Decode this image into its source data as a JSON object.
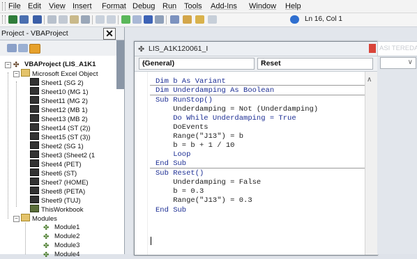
{
  "menu": {
    "items": [
      "File",
      "Edit",
      "View",
      "Insert",
      "Format",
      "Debug",
      "Run",
      "Tools",
      "Add-Ins",
      "Window",
      "Help"
    ]
  },
  "toolbar": {
    "cursor_position": "Ln 16, Col 1",
    "icons": [
      "excel-icon",
      "insert-icon",
      "save-icon",
      "cut-icon",
      "copy-icon",
      "paste-icon",
      "find-icon",
      "undo-icon",
      "redo-icon",
      "run-icon",
      "break-icon",
      "reset-icon",
      "design-mode-icon",
      "project-explorer-icon",
      "properties-icon",
      "object-browser-icon",
      "toolbox-icon",
      "help-icon"
    ]
  },
  "project_panel": {
    "title": "Project - VBAProject",
    "close_label": "✕",
    "root": "VBAProject (LIS_A1K1",
    "objects_folder": "Microsoft Excel Object",
    "sheets": [
      "Sheet1 (SG 2)",
      "Sheet10 (MG 1)",
      "Sheet11 (MG 2)",
      "Sheet12 (MB 1)",
      "Sheet13 (MB 2)",
      "Sheet14 (ST (2))",
      "Sheet15 (ST (3))",
      "Sheet2 (SG 1)",
      "Sheet3 (Sheet2 (1",
      "Sheet4 (PET)",
      "Sheet6 (ST)",
      "Sheet7 (HOME)",
      "Sheet8 (PETA)",
      "Sheet9 (TUJ)"
    ],
    "workbook": "ThisWorkbook",
    "modules_folder": "Modules",
    "modules": [
      "Module1",
      "Module2",
      "Module3",
      "Module4"
    ]
  },
  "code_window": {
    "title": "LIS_A1K120061_I",
    "object_combo": "(General)",
    "procedure_combo": "Reset",
    "lines": [
      "Dim b As Variant",
      "Dim Underdamping As Boolean",
      "Sub RunStop()",
      "    Underdamping = Not (Underdamping)",
      "    Do While Underdamping = True",
      "    DoEvents",
      "    Range(\"J13\") = b",
      "    b = b + 1 / 10",
      "    Loop",
      "End Sub",
      "Sub Reset()",
      "    Underdamping = False",
      "    b = 0.3",
      "    Range(\"J13\") = 0.3",
      "End Sub"
    ]
  },
  "right_panel": {
    "title": "ASI TEREDA"
  }
}
